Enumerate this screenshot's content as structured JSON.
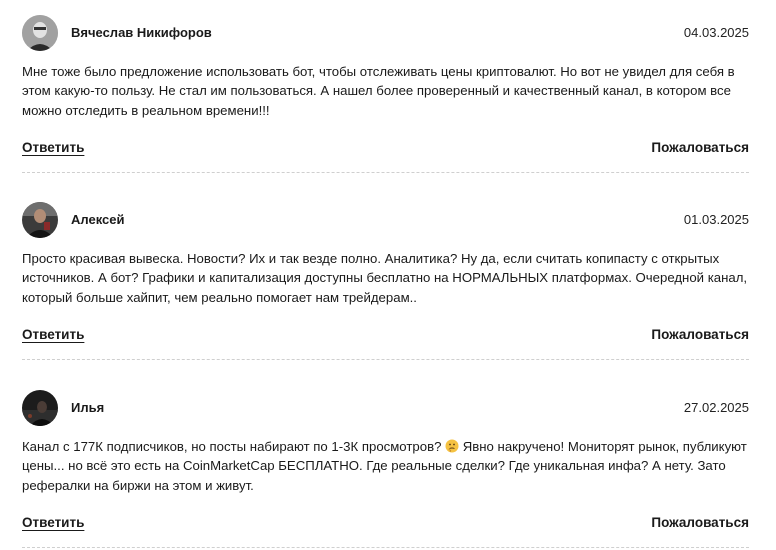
{
  "comments": [
    {
      "author": "Вячеслав Никифоров",
      "date": "04.03.2025",
      "text": "Мне тоже было предложение использовать бот, чтобы отслеживать цены криптовалют. Но вот не увидел для себя в этом какую-то пользу. Не стал им пользоваться. А нашел более проверенный и качественный канал, в котором все можно отследить в реальном времени!!!",
      "reply_label": "Ответить",
      "report_label": "Пожаловаться"
    },
    {
      "author": "Алексей",
      "date": "01.03.2025",
      "text": "Просто красивая вывеска. Новости? Их и так везде полно. Аналитика? Ну да, если считать копипасту с открытых источников. А бот? Графики и капитализация доступны бесплатно на НОРМАЛЬНЫХ платформах. Очередной канал, который больше хайпит, чем реально помогает нам трейдерам..",
      "reply_label": "Ответить",
      "report_label": "Пожаловаться"
    },
    {
      "author": "Илья",
      "date": "27.02.2025",
      "text_before_emoji": "Канал с 177К подписчиков, но посты набирают по 1-3К просмотров? ",
      "emoji": "thinking-face-icon",
      "text_after_emoji": " Явно накручено! Мониторят рынок, публикуют цены... но всё это есть на CoinMarketCap БЕСПЛАТНО. Где реальные сделки? Где уникальная инфа? А нету. Зато рефералки на биржи на этом и живут.",
      "reply_label": "Ответить",
      "report_label": "Пожаловаться"
    }
  ]
}
